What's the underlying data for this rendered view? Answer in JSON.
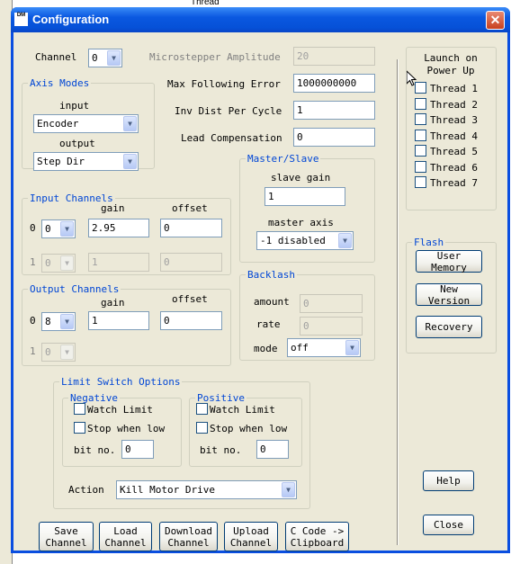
{
  "background": {
    "tab_text": "Thread"
  },
  "window": {
    "title": "Configuration",
    "icon_label": "DM"
  },
  "channel": {
    "label": "Channel",
    "value": "0"
  },
  "microstepper": {
    "label": "Microstepper Amplitude",
    "value": "20"
  },
  "max_following": {
    "label": "Max Following Error",
    "value": "1000000000"
  },
  "inv_dist": {
    "label": "Inv Dist Per Cycle",
    "value": "1"
  },
  "lead_comp": {
    "label": "Lead Compensation",
    "value": "0"
  },
  "axis_modes": {
    "legend": "Axis Modes",
    "input_label": "input",
    "input_value": "Encoder",
    "output_label": "output",
    "output_value": "Step Dir"
  },
  "input_channels": {
    "legend": "Input Channels",
    "gain_header": "gain",
    "offset_header": "offset",
    "rows": [
      {
        "index": "0",
        "channel": "0",
        "gain": "2.95",
        "offset": "0"
      },
      {
        "index": "1",
        "channel": "0",
        "gain": "1",
        "offset": "0"
      }
    ]
  },
  "output_channels": {
    "legend": "Output Channels",
    "gain_header": "gain",
    "offset_header": "offset",
    "rows": [
      {
        "index": "0",
        "channel": "8",
        "gain": "1",
        "offset": "0"
      },
      {
        "index": "1",
        "channel": "0"
      }
    ]
  },
  "master_slave": {
    "legend": "Master/Slave",
    "slave_gain_label": "slave gain",
    "slave_gain_value": "1",
    "master_axis_label": "master axis",
    "master_axis_value": "-1 disabled"
  },
  "backlash": {
    "legend": "Backlash",
    "amount_label": "amount",
    "amount_value": "0",
    "rate_label": "rate",
    "rate_value": "0",
    "mode_label": "mode",
    "mode_value": "off"
  },
  "limit_switch": {
    "legend": "Limit Switch Options",
    "negative": {
      "legend": "Negative",
      "watch_limit": "Watch Limit",
      "stop_when_low": "Stop when low",
      "bit_label": "bit no.",
      "bit_value": "0"
    },
    "positive": {
      "legend": "Positive",
      "watch_limit": "Watch Limit",
      "stop_when_low": "Stop when low",
      "bit_label": "bit no.",
      "bit_value": "0"
    },
    "action_label": "Action",
    "action_value": "Kill Motor Drive"
  },
  "buttons": {
    "save": "Save\nChannel",
    "load": "Load\nChannel",
    "download": "Download\nChannel",
    "upload": "Upload\nChannel",
    "ccode": "C Code ->\nClipboard",
    "help": "Help",
    "close": "Close"
  },
  "launch": {
    "legend": "Launch on\nPower Up",
    "threads": [
      "Thread 1",
      "Thread 2",
      "Thread 3",
      "Thread 4",
      "Thread 5",
      "Thread 6",
      "Thread 7"
    ]
  },
  "flash": {
    "legend": "Flash",
    "user_memory": "User Memory",
    "new_version": "New Version",
    "recovery": "Recovery"
  },
  "colors": {
    "title_bar": "#0a58e0",
    "dialog_bg": "#ece9d8",
    "group_legend": "#0046d5"
  }
}
